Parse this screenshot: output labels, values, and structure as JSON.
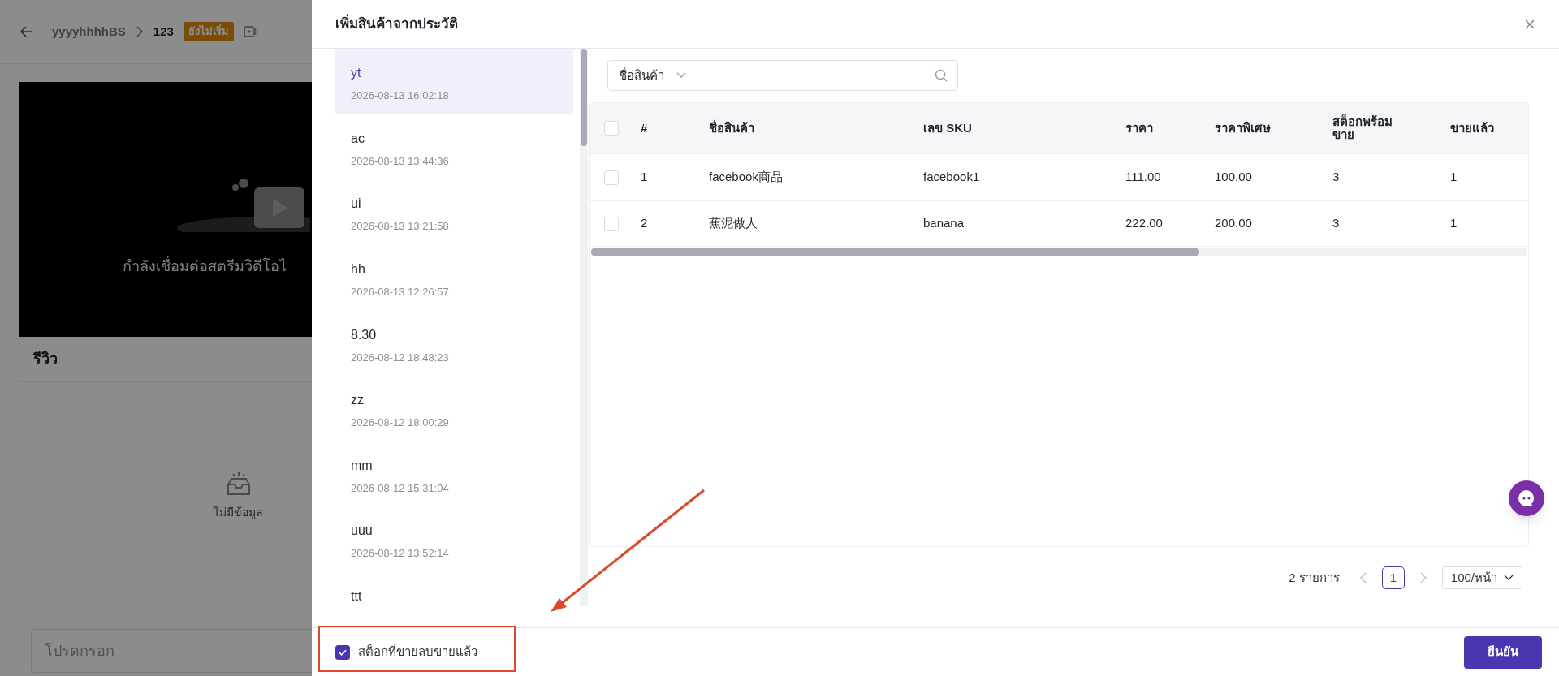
{
  "background": {
    "breadcrumb": {
      "parent": "yyyyhhhhBS",
      "current": "123",
      "status": "ยังไม่เริ่ม"
    },
    "video_message": "กำลังเชื่อมต่อสตรีมวิดีโอไ",
    "review_title": "รีวิว",
    "empty_text": "ไม่มีข้อมูล",
    "comment_input": {
      "placeholder": "โปรดกรอก"
    }
  },
  "dialog": {
    "title": "เพิ่มสินค้าจากประวัติ",
    "history": [
      {
        "name": "yt",
        "time": "2026-08-13 16:02:18",
        "selected": true
      },
      {
        "name": "ac",
        "time": "2026-08-13 13:44:36",
        "selected": false
      },
      {
        "name": "ui",
        "time": "2026-08-13 13:21:58",
        "selected": false
      },
      {
        "name": "hh",
        "time": "2026-08-13 12:26:57",
        "selected": false
      },
      {
        "name": "8.30",
        "time": "2026-08-12 18:48:23",
        "selected": false
      },
      {
        "name": "zz",
        "time": "2026-08-12 18:00:29",
        "selected": false
      },
      {
        "name": "mm",
        "time": "2026-08-12 15:31:04",
        "selected": false
      },
      {
        "name": "uuu",
        "time": "2026-08-12 13:52:14",
        "selected": false
      },
      {
        "name": "ttt",
        "selected": false
      }
    ],
    "search": {
      "filter": "ชื่อสินค้า"
    },
    "table": {
      "all_checked": false,
      "columns": [
        "#",
        "ชื่อสินค้า",
        "เลข SKU",
        "ราคา",
        "ราคาพิเศษ",
        "สต็อกพร้อมขาย",
        "ขายแล้ว"
      ],
      "rows": [
        {
          "checked": false,
          "cells": [
            "1",
            "facebook商品",
            "facebook1",
            "111.00",
            "100.00",
            "3",
            "1"
          ]
        },
        {
          "checked": false,
          "cells": [
            "2",
            "蕉泥做人",
            "banana",
            "222.00",
            "200.00",
            "3",
            "1"
          ]
        }
      ]
    },
    "pagination": {
      "total": "2 รายการ",
      "pages": [
        {
          "label": "1",
          "selected": true
        }
      ],
      "page_size": "100/หน้า"
    },
    "footer": {
      "option": {
        "label": "สต็อกที่ขายลบขายแล้ว",
        "checked": true
      },
      "confirm": "ยืนยัน"
    }
  }
}
